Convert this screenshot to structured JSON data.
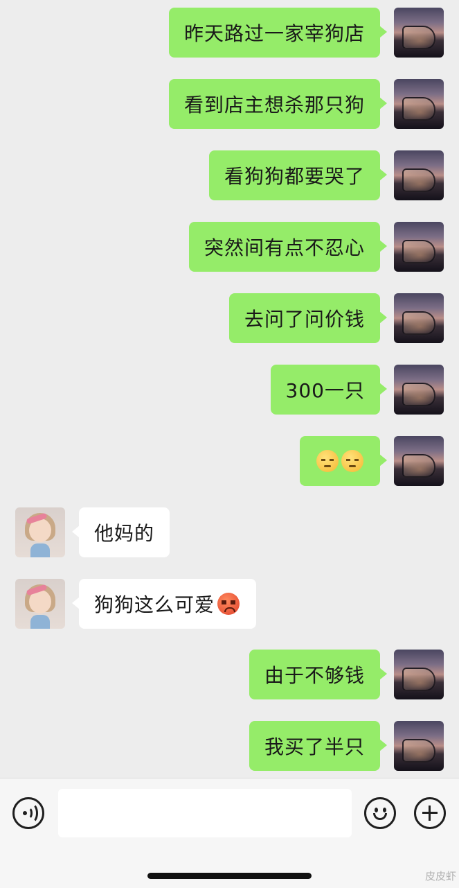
{
  "messages": [
    {
      "side": "right",
      "text": "昨天路过一家宰狗店",
      "avatar": "self-avatar"
    },
    {
      "side": "right",
      "text": "看到店主想杀那只狗",
      "avatar": "self-avatar"
    },
    {
      "side": "right",
      "text": "看狗狗都要哭了",
      "avatar": "self-avatar"
    },
    {
      "side": "right",
      "text": "突然间有点不忍心",
      "avatar": "self-avatar"
    },
    {
      "side": "right",
      "text": "去问了问价钱",
      "avatar": "self-avatar"
    },
    {
      "side": "right",
      "text": "300一只",
      "avatar": "self-avatar"
    },
    {
      "side": "right",
      "text": "",
      "emoji": [
        "pensive-face-emoji",
        "pensive-face-emoji"
      ],
      "avatar": "self-avatar"
    },
    {
      "side": "left",
      "text": "他妈的",
      "avatar": "girl-avatar"
    },
    {
      "side": "left",
      "text": "狗狗这么可爱",
      "emoji_suffix": "angry-face-emoji",
      "avatar": "girl-avatar"
    },
    {
      "side": "right",
      "text": "由于不够钱",
      "avatar": "self-avatar"
    },
    {
      "side": "right",
      "text": "我买了半只",
      "avatar": "self-avatar"
    }
  ],
  "input_bar": {
    "voice_icon": "voice-icon",
    "input_value": "",
    "emoji_icon": "emoji-icon",
    "plus_icon": "plus-icon"
  },
  "watermark": "皮皮虾",
  "colors": {
    "background": "#ededed",
    "sent_bubble": "#95ec69",
    "received_bubble": "#ffffff",
    "input_bar": "#f6f6f6"
  }
}
